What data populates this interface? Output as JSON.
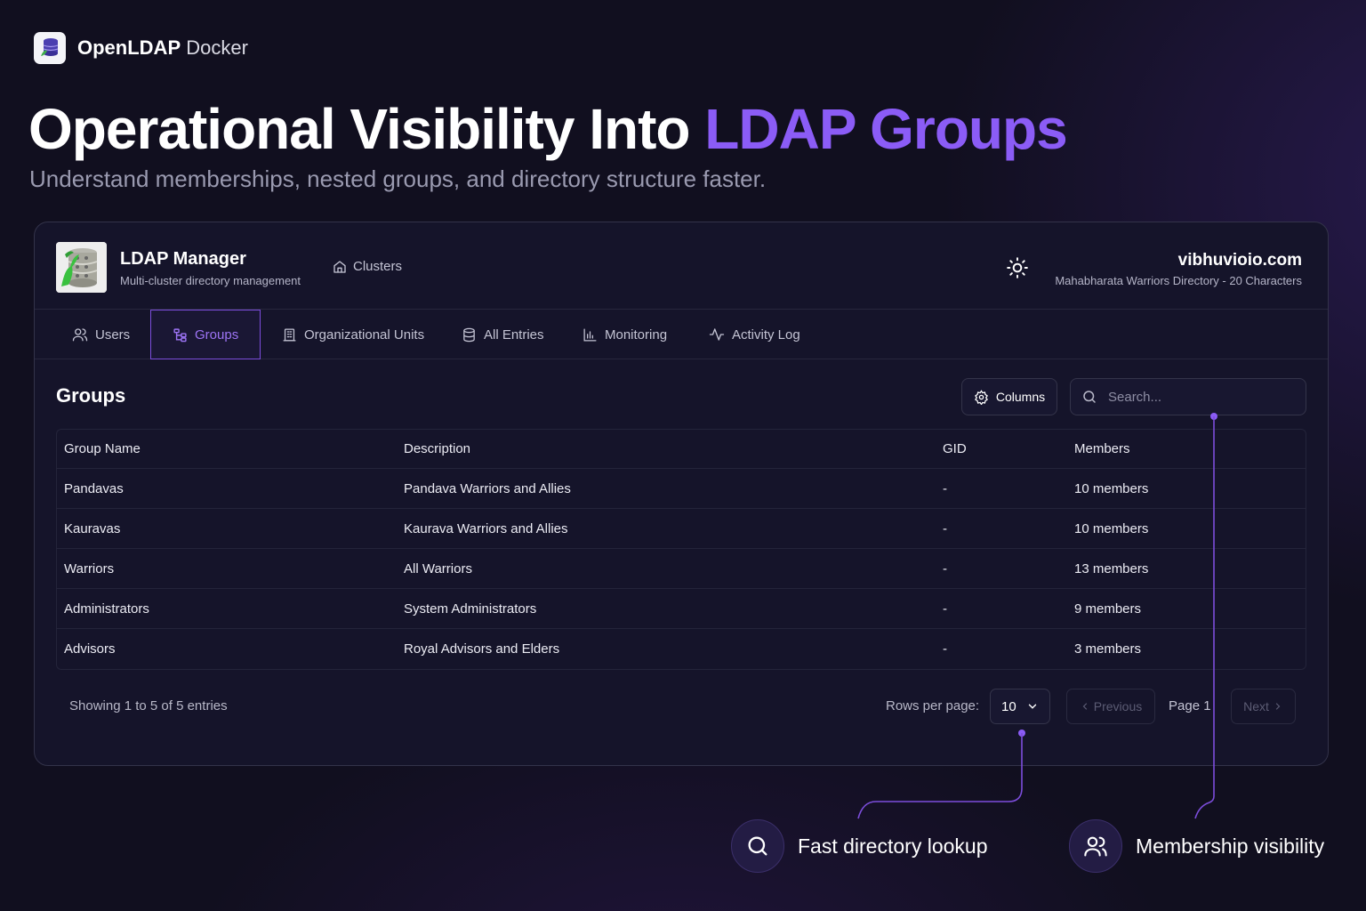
{
  "brand": {
    "name_bold": "OpenLDAP",
    "name_light": "Docker"
  },
  "hero": {
    "headline_main": "Operational Visibility Into",
    "headline_accent": "LDAP Groups",
    "subheadline": "Understand memberships, nested groups, and directory structure faster."
  },
  "app": {
    "title": "LDAP Manager",
    "subtitle": "Multi-cluster directory management",
    "clusters_label": "Clusters",
    "domain": "vibhuvioio.com",
    "directory": "Mahabharata Warriors Directory - 20 Characters"
  },
  "tabs": [
    {
      "label": "Users",
      "icon": "users-icon"
    },
    {
      "label": "Groups",
      "icon": "groups-icon",
      "active": true
    },
    {
      "label": "Organizational Units",
      "icon": "building-icon"
    },
    {
      "label": "All Entries",
      "icon": "database-icon"
    },
    {
      "label": "Monitoring",
      "icon": "bar-chart-icon"
    },
    {
      "label": "Activity Log",
      "icon": "activity-icon"
    }
  ],
  "groups": {
    "title": "Groups",
    "columns_label": "Columns",
    "search_placeholder": "Search...",
    "headers": [
      "Group Name",
      "Description",
      "GID",
      "Members"
    ],
    "rows": [
      [
        "Pandavas",
        "Pandava Warriors and Allies",
        "-",
        "10 members"
      ],
      [
        "Kauravas",
        "Kaurava Warriors and Allies",
        "-",
        "10 members"
      ],
      [
        "Warriors",
        "All Warriors",
        "-",
        "13 members"
      ],
      [
        "Administrators",
        "System Administrators",
        "-",
        "9 members"
      ],
      [
        "Advisors",
        "Royal Advisors and Elders",
        "-",
        "3 members"
      ]
    ]
  },
  "pagination": {
    "showing": "Showing 1 to 5 of 5 entries",
    "rows_per_page_label": "Rows per page:",
    "rows_per_page_value": "10",
    "previous": "Previous",
    "page": "Page 1",
    "next": "Next"
  },
  "features": [
    {
      "label": "Fast directory lookup",
      "icon": "search-icon"
    },
    {
      "label": "Membership visibility",
      "icon": "users-icon"
    }
  ],
  "colors": {
    "accent": "#8b5cf6",
    "background": "#110f1f",
    "panel": "#15142a"
  }
}
